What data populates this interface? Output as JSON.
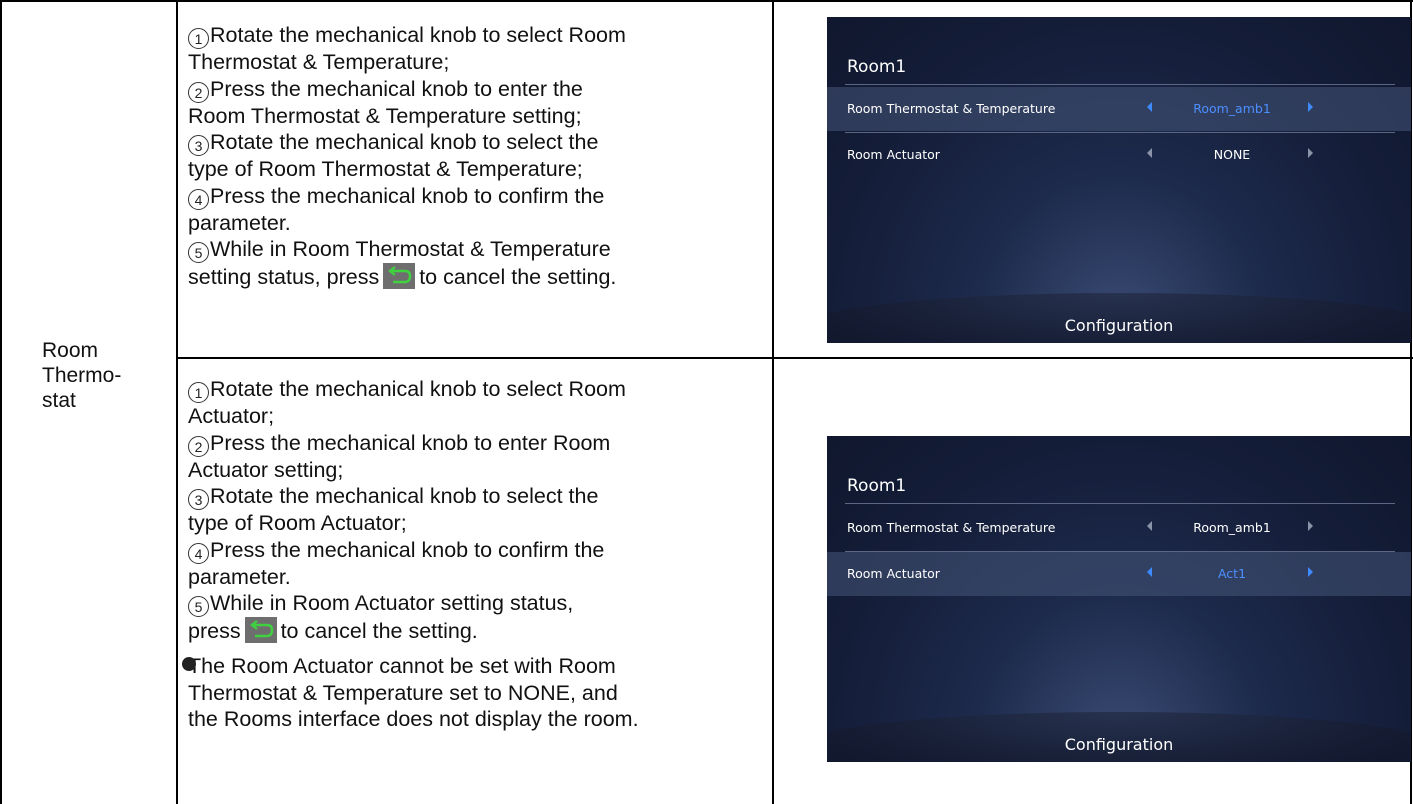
{
  "row_label": [
    "Room",
    "Thermo-",
    "stat"
  ],
  "block1": {
    "lines": [
      {
        "num": "1",
        "text": "Rotate the mechanical knob to select Room"
      },
      {
        "num": "",
        "text": "Thermostat & Temperature;"
      },
      {
        "num": "2",
        "text": "Press the mechanical knob to enter the"
      },
      {
        "num": "",
        "text": "Room Thermostat & Temperature setting;"
      },
      {
        "num": "3",
        "text": "Rotate the mechanical knob to select the"
      },
      {
        "num": "",
        "text": "type of Room Thermostat & Temperature;"
      },
      {
        "num": "4",
        "text": "Press the mechanical knob to confirm the"
      },
      {
        "num": "",
        "text": "parameter."
      },
      {
        "num": "5",
        "text": "While in Room Thermostat & Temperature"
      }
    ],
    "last_prefix": "setting status, press",
    "last_suffix": "to cancel the setting."
  },
  "block2": {
    "lines": [
      {
        "num": "1",
        "text": "Rotate the mechanical knob to select Room"
      },
      {
        "num": "",
        "text": "Actuator;"
      },
      {
        "num": "2",
        "text": "Press the mechanical knob to enter Room"
      },
      {
        "num": "",
        "text": "Actuator setting;"
      },
      {
        "num": "3",
        "text": "Rotate the mechanical knob to select the"
      },
      {
        "num": "",
        "text": "type of Room Actuator;"
      },
      {
        "num": "4",
        "text": "Press the mechanical knob to confirm the"
      },
      {
        "num": "",
        "text": "parameter."
      },
      {
        "num": "5",
        "text": "While in Room Actuator setting status,"
      }
    ],
    "last_prefix": "press",
    "last_suffix": "to cancel the setting.",
    "note_lines": [
      "The Room Actuator cannot be set with Room",
      "Thermostat & Temperature set to NONE, and",
      "the Rooms interface does not display the room."
    ]
  },
  "screen1": {
    "title": "Room1",
    "rows": [
      {
        "name": "Room Thermostat & Temperature",
        "value": "Room_amb1",
        "active": true
      },
      {
        "name": "Room Actuator",
        "value": "NONE",
        "active": false
      }
    ],
    "footer": "Configuration"
  },
  "screen2": {
    "title": "Room1",
    "rows": [
      {
        "name": "Room Thermostat & Temperature",
        "value": "Room_amb1",
        "active": false
      },
      {
        "name": "Room Actuator",
        "value": "Act1",
        "active": true
      }
    ],
    "footer": "Configuration"
  },
  "icons": {
    "back": "back-arrow-icon",
    "bullet": "bullet-icon"
  },
  "colors": {
    "active_value": "#4c8fff",
    "active_arrow": "#3d8bff",
    "back_icon_bg": "#6e6e6e"
  }
}
